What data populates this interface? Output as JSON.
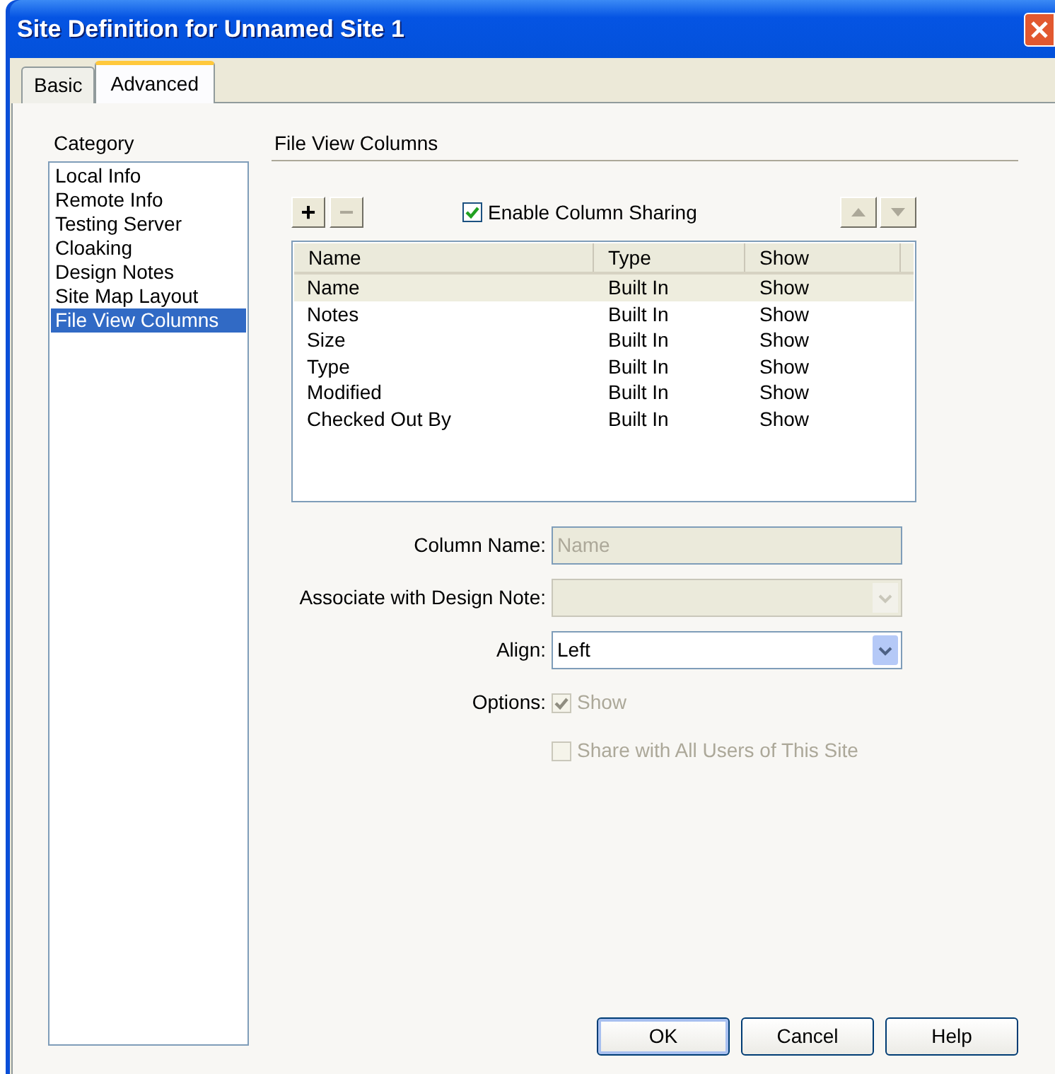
{
  "window": {
    "title": "Site Definition for Unnamed Site 1"
  },
  "tabs": [
    {
      "label": "Basic",
      "selected": false
    },
    {
      "label": "Advanced",
      "selected": true
    }
  ],
  "category": {
    "label": "Category",
    "items": [
      {
        "label": "Local Info",
        "selected": false
      },
      {
        "label": "Remote Info",
        "selected": false
      },
      {
        "label": "Testing Server",
        "selected": false
      },
      {
        "label": "Cloaking",
        "selected": false
      },
      {
        "label": "Design Notes",
        "selected": false
      },
      {
        "label": "Site Map Layout",
        "selected": false
      },
      {
        "label": "File View Columns",
        "selected": true
      }
    ]
  },
  "section_title": "File View Columns",
  "toolbar": {
    "add": {
      "label": "+",
      "disabled": false
    },
    "remove": {
      "label": "−",
      "disabled": true
    },
    "enable_sharing": {
      "label": "Enable Column Sharing",
      "checked": true
    },
    "move_up": {
      "disabled": true
    },
    "move_down": {
      "disabled": true
    }
  },
  "table": {
    "columns": [
      "Name",
      "Type",
      "Show"
    ],
    "rows": [
      {
        "cells": [
          "Name",
          "Built In",
          "Show"
        ],
        "selected": true
      },
      {
        "cells": [
          "Notes",
          "Built In",
          "Show"
        ],
        "selected": false
      },
      {
        "cells": [
          "Size",
          "Built In",
          "Show"
        ],
        "selected": false
      },
      {
        "cells": [
          "Type",
          "Built In",
          "Show"
        ],
        "selected": false
      },
      {
        "cells": [
          "Modified",
          "Built In",
          "Show"
        ],
        "selected": false
      },
      {
        "cells": [
          "Checked Out By",
          "Built In",
          "Show"
        ],
        "selected": false
      }
    ]
  },
  "form": {
    "column_name": {
      "label": "Column Name:",
      "value": "Name",
      "disabled": true
    },
    "design_note": {
      "label": "Associate with Design Note:",
      "disabled": true
    },
    "align": {
      "label": "Align:",
      "value": "Left",
      "disabled": false
    },
    "options_label": "Options:",
    "options": [
      {
        "label": "Show",
        "checked": true,
        "disabled": true
      },
      {
        "label": "Share with All Users of This Site",
        "checked": false,
        "disabled": true
      }
    ]
  },
  "buttons": [
    {
      "label": "OK",
      "default": true
    },
    {
      "label": "Cancel",
      "default": false
    },
    {
      "label": "Help",
      "default": false
    }
  ]
}
